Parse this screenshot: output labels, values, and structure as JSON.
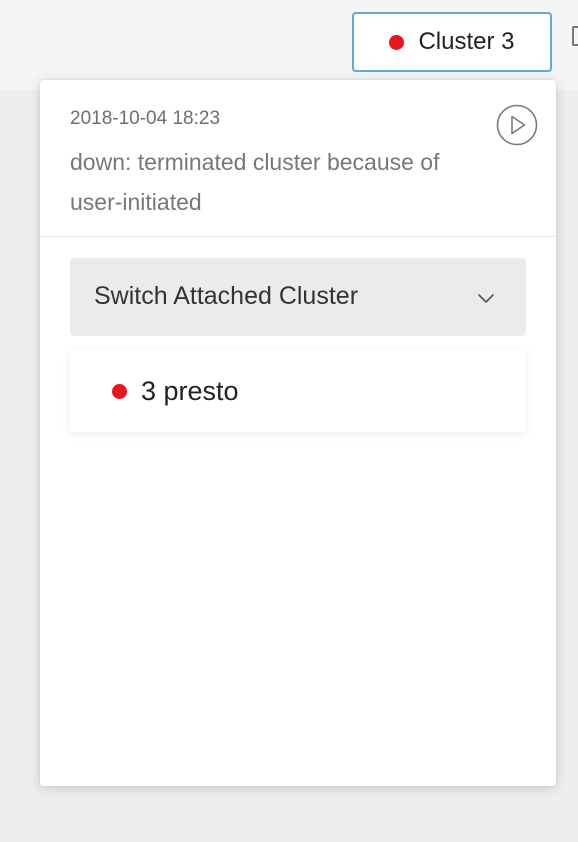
{
  "header": {
    "cluster_button": {
      "label": "Cluster 3",
      "status_color": "#e8141e"
    }
  },
  "popover": {
    "timestamp": "2018-10-04 18:23",
    "status_message": "down: terminated cluster because of user-initiated",
    "play_icon": "play-circle-icon",
    "switch_dropdown": {
      "label": "Switch Attached Cluster",
      "icon": "chevron-down-icon"
    },
    "clusters": [
      {
        "label": "3 presto",
        "status_color": "#e8141e"
      }
    ]
  },
  "colors": {
    "accent_border": "#62a7d6",
    "status_down": "#e8141e"
  }
}
